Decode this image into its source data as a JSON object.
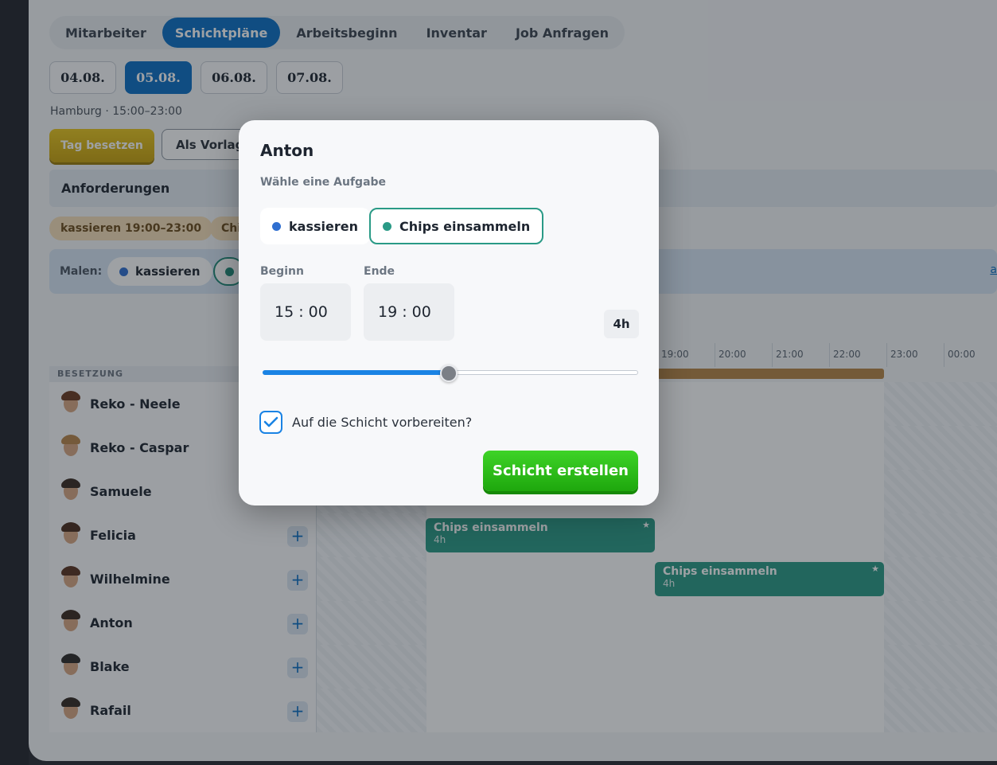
{
  "tabs": [
    "Mitarbeiter",
    "Schichtpläne",
    "Arbeitsbeginn",
    "Inventar",
    "Job Anfragen"
  ],
  "active_tab": "Schichtpläne",
  "dates": [
    "04.08.",
    "05.08.",
    "06.08.",
    "07.08."
  ],
  "active_date": "05.08.",
  "location": "Hamburg · 15:00–23:00",
  "buttons": {
    "tag_besetzen": "Tag besetzen",
    "als_vorlage": "Als Vorlage"
  },
  "requirements": {
    "title": "Anforderungen",
    "chips": [
      "kassieren 19:00–23:00",
      "Chi"
    ]
  },
  "paint": {
    "label": "Malen:",
    "chips": [
      {
        "label": "kassieren",
        "color": "#2f6fd0"
      },
      {
        "label": "",
        "color": "#1f8a78"
      }
    ],
    "link": "a"
  },
  "grid": {
    "header": "BESETZUNG",
    "hours": [
      "19:00",
      "20:00",
      "21:00",
      "22:00",
      "23:00",
      "00:00"
    ],
    "rows": [
      {
        "name": "Reko - Neele",
        "hair": "#6b3a1f"
      },
      {
        "name": "Reko - Caspar",
        "hair": "#b8864a"
      },
      {
        "name": "Samuele",
        "hair": "#3a2a22"
      },
      {
        "name": "Felicia",
        "hair": "#4a2c1c"
      },
      {
        "name": "Wilhelmine",
        "hair": "#5a3320"
      },
      {
        "name": "Anton",
        "hair": "#3b2a20"
      },
      {
        "name": "Blake",
        "hair": "#2e2a28"
      },
      {
        "name": "Rafail",
        "hair": "#352a24"
      }
    ],
    "plus": "+",
    "shifts": [
      {
        "title": "Chips einsammeln",
        "duration": "4h",
        "star": "★"
      },
      {
        "title": "Chips einsammeln",
        "duration": "4h",
        "star": "★"
      }
    ]
  },
  "modal": {
    "title": "Anton",
    "subtitle": "Wähle eine Aufgabe",
    "tasks": [
      {
        "label": "kassieren",
        "color": "#2f6fd0"
      },
      {
        "label": "Chips einsammeln",
        "color": "#2a9a86"
      }
    ],
    "selected_task": "Chips einsammeln",
    "begin_label": "Beginn",
    "end_label": "Ende",
    "begin_value": "15 : 00",
    "end_value": "19 : 00",
    "duration": "4h",
    "slider_fraction": 0.5,
    "checkbox_label": "Auf die Schicht vorbereiten?",
    "checkbox_checked": true,
    "submit_label": "Schicht erstellen"
  },
  "colors": {
    "accent": "#0c6fc4",
    "teal": "#2a9a86",
    "green": "#28b815",
    "gold": "#d9b411"
  }
}
